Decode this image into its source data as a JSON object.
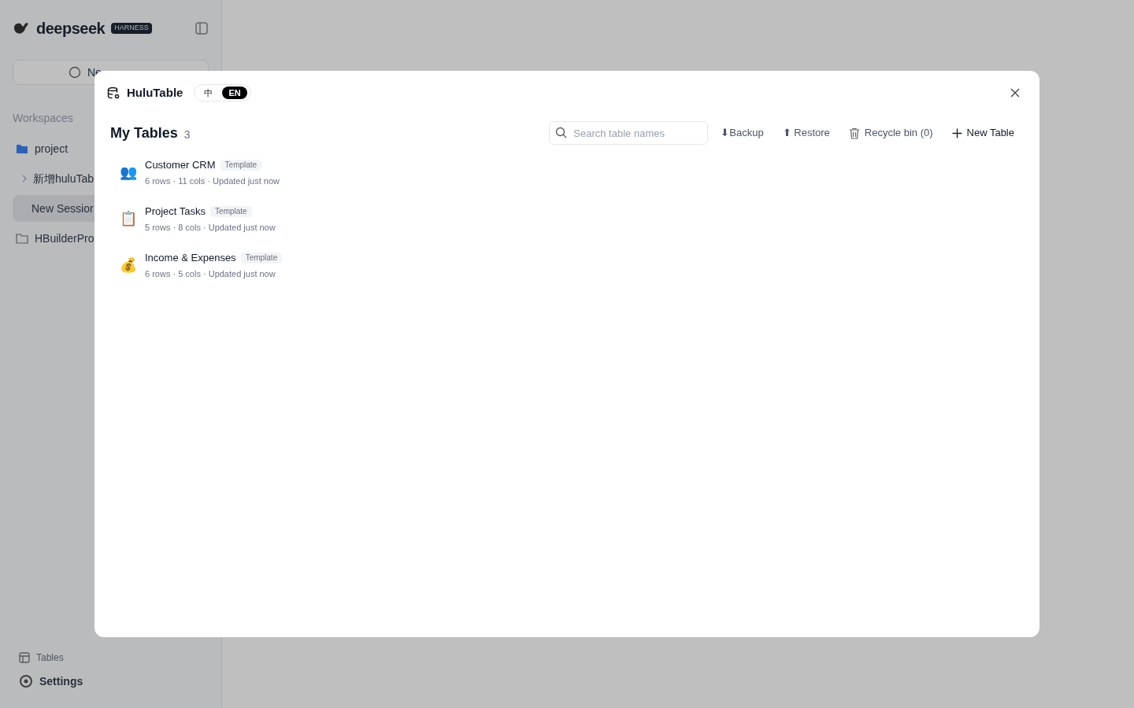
{
  "sidebar": {
    "logo": "deepseek",
    "logo_badge": "HARNESS",
    "new_session": "Ne",
    "section": "Workspaces",
    "items": [
      {
        "label": "project",
        "kind": "folder",
        "selected": false
      },
      {
        "label": "新增huluTab",
        "kind": "thread",
        "selected": false
      },
      {
        "label": "New Sessior",
        "kind": "session",
        "selected": true
      },
      {
        "label": "HBuilderPro",
        "kind": "folder-outline",
        "selected": false
      }
    ],
    "footer": [
      {
        "label": "Tables",
        "kind": "tables"
      },
      {
        "label": "Settings",
        "kind": "settings"
      }
    ]
  },
  "dialog": {
    "title": "HuluTable",
    "languages": [
      {
        "label": "中",
        "selected": false
      },
      {
        "label": "EN",
        "selected": true
      }
    ],
    "heading": "My Tables",
    "count": "3",
    "search": {
      "placeholder": "Search table names"
    },
    "actions": [
      {
        "label": "⬇Backup",
        "kind": "plain"
      },
      {
        "label": "⬆ Restore",
        "kind": "plain"
      },
      {
        "label": "Recycle bin (0)",
        "kind": "trash"
      },
      {
        "label": "New Table",
        "kind": "add"
      }
    ],
    "tables": [
      {
        "icon": "👥",
        "name": "Customer CRM",
        "badge": "Template",
        "meta": "6 rows · 11 cols · Updated just now"
      },
      {
        "icon": "📋",
        "name": "Project Tasks",
        "badge": "Template",
        "meta": "5 rows · 8 cols · Updated just now"
      },
      {
        "icon": "💰",
        "name": "Income & Expenses",
        "badge": "Template",
        "meta": "6 rows · 5 cols · Updated just now"
      }
    ]
  }
}
